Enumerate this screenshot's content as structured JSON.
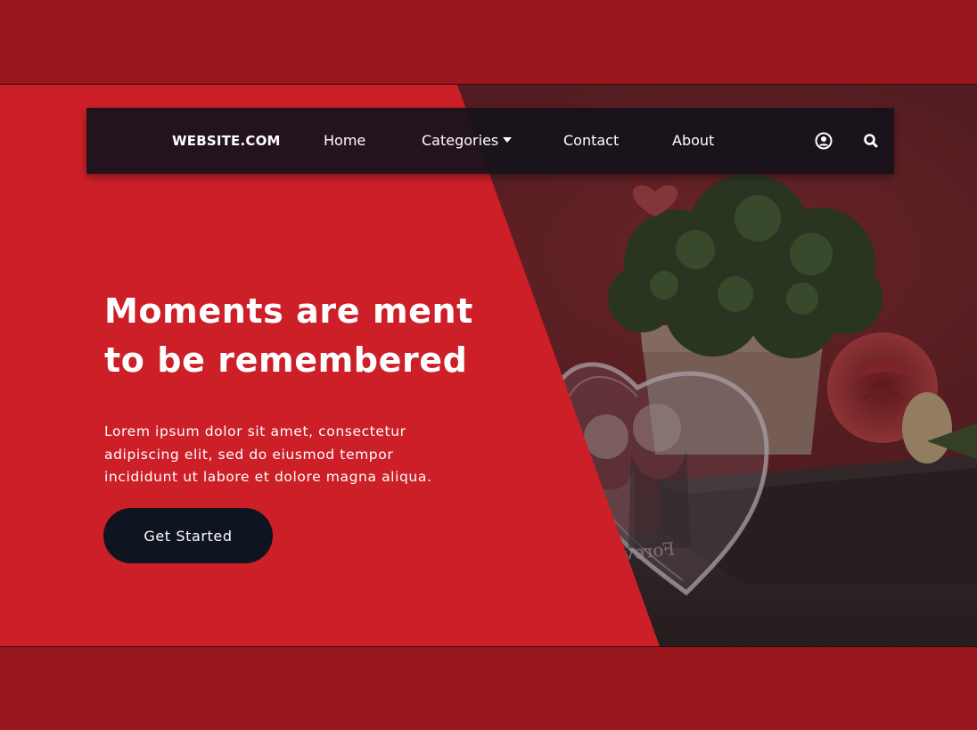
{
  "nav": {
    "logo": "WEBSITE.COM",
    "items": [
      {
        "label": "Home"
      },
      {
        "label": "Categories"
      },
      {
        "label": "Contact"
      },
      {
        "label": "About"
      }
    ],
    "icons": [
      "user-circle-icon",
      "search-icon"
    ]
  },
  "hero": {
    "headline_line1": "Moments are ment",
    "headline_line2": "to be remembered",
    "description_line1": "Lorem ipsum dolor sit amet, consectetur",
    "description_line2": "adipiscing elit, sed do eiusmod tempor",
    "description_line3": "incididunt ut labore et dolore magna aliqua.",
    "cta_label": "Get Started",
    "image_engraving": "Forever"
  },
  "colors": {
    "page_background": "#98181e",
    "hero_background": "#cc1f28",
    "navbar_background": "#16121c",
    "cta_background": "#0e1420",
    "text": "#ffffff"
  }
}
